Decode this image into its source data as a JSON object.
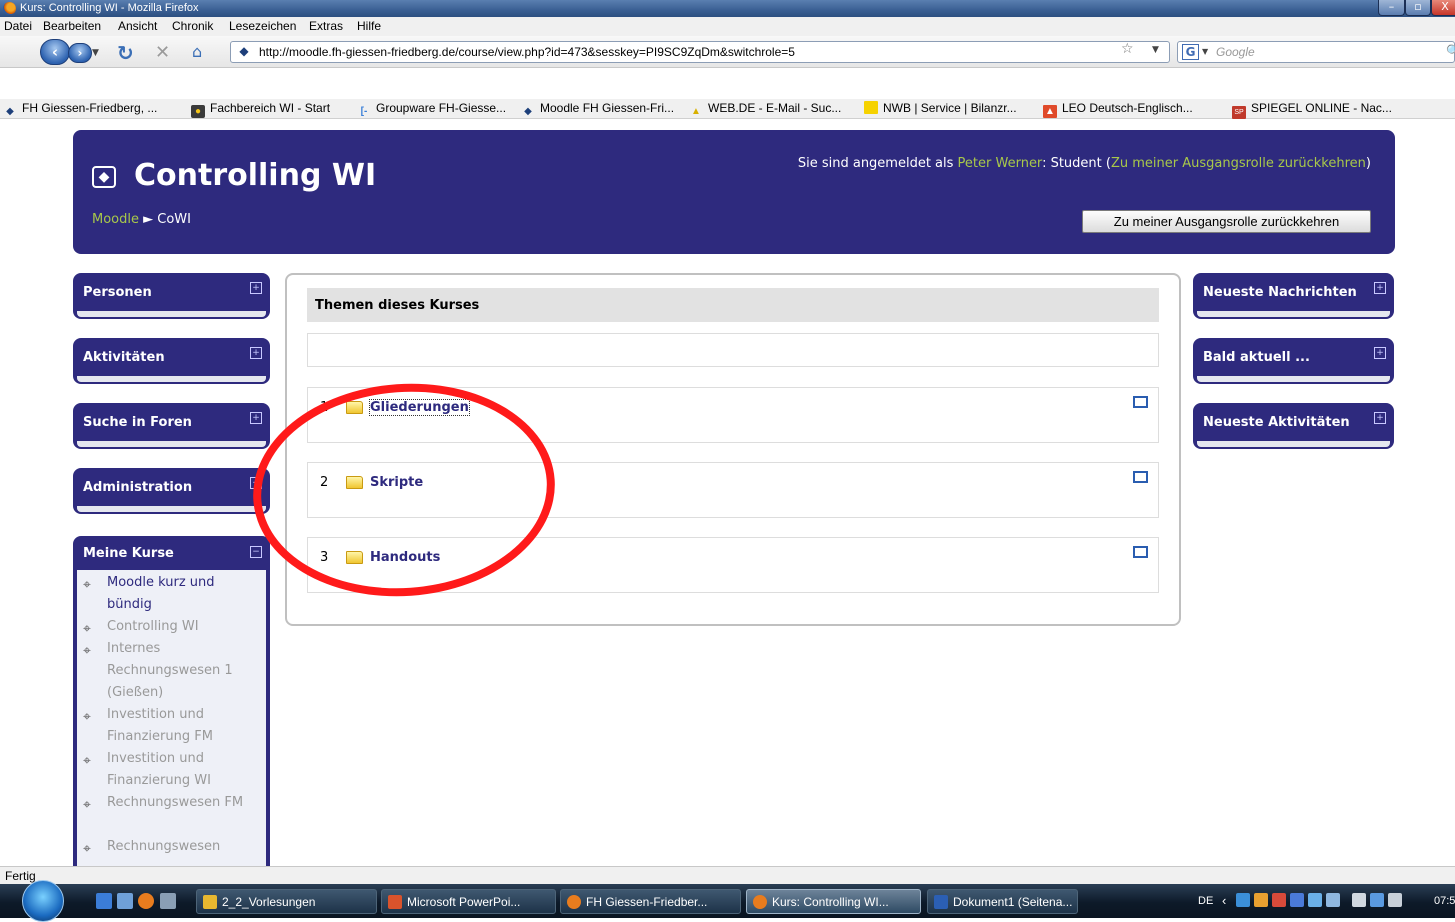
{
  "window": {
    "title": "Kurs: Controlling WI - Mozilla Firefox",
    "controls": {
      "minimize": "–",
      "maximize": "▫",
      "close": "X"
    }
  },
  "menubar": [
    "Datei",
    "Bearbeiten",
    "Ansicht",
    "Chronik",
    "Lesezeichen",
    "Extras",
    "Hilfe"
  ],
  "navbar": {
    "url": "http://moodle.fh-giessen-friedberg.de/course/view.php?id=473&sesskey=PI9SC9ZqDm&switchrole=5",
    "search_placeholder": "Google",
    "search_engine": "G"
  },
  "bookmarks": [
    {
      "label": "FH Giessen-Friedberg, ...",
      "icon": "moodle-diamond-icon"
    },
    {
      "label": "Fachbereich WI - Start",
      "icon": "fachbereich-icon"
    },
    {
      "label": "Groupware FH-Giesse...",
      "icon": "groupware-icon"
    },
    {
      "label": "Moodle FH Giessen-Fri...",
      "icon": "moodle-diamond-icon"
    },
    {
      "label": "WEB.DE - E-Mail - Suc...",
      "icon": "webde-icon"
    },
    {
      "label": "NWB | Service | Bilanzr...",
      "icon": "nwb-icon"
    },
    {
      "label": "LEO Deutsch-Englisch...",
      "icon": "leo-icon"
    },
    {
      "label": "SPIEGEL ONLINE - Nac...",
      "icon": "spiegel-icon"
    }
  ],
  "header": {
    "course_title": "Controlling WI",
    "login_prefix": "Sie sind angemeldet als ",
    "user_name": "Peter Werner",
    "role_text": ": Student (",
    "role_link": "Zu meiner Ausgangsrolle zurückkehren",
    "role_suffix": ")",
    "breadcrumb_home": "Moodle",
    "breadcrumb_sep": "►",
    "breadcrumb_current": "CoWI",
    "return_button": "Zu meiner Ausgangsrolle zurückkehren"
  },
  "left_blocks": [
    "Personen",
    "Aktivitäten",
    "Suche in Foren",
    "Administration"
  ],
  "my_courses": {
    "title": "Meine Kurse",
    "items": [
      {
        "label": "Moodle kurz und bündig",
        "state": "active"
      },
      {
        "label": "Controlling WI",
        "state": "dim"
      },
      {
        "label": "Internes Rechnungswesen 1 (Gießen)",
        "state": "dim"
      },
      {
        "label": "Investition und Finanzierung FM",
        "state": "dim"
      },
      {
        "label": "Investition und Finanzierung WI",
        "state": "dim"
      },
      {
        "label": "Rechnungswesen FM",
        "state": "dim"
      },
      {
        "label": "Rechnungswesen",
        "state": "dim"
      }
    ]
  },
  "right_blocks": [
    "Neueste Nachrichten",
    "Bald aktuell ...",
    "Neueste Aktivitäten"
  ],
  "content": {
    "heading": "Themen dieses Kurses",
    "topics": [
      {
        "number": "1",
        "label": "Gliederungen"
      },
      {
        "number": "2",
        "label": "Skripte"
      },
      {
        "number": "3",
        "label": "Handouts"
      }
    ]
  },
  "annotation": {
    "shape": "ellipse",
    "color": "#ff1a1a"
  },
  "statusbar": "Fertig",
  "taskbar": {
    "tasks": [
      {
        "label": "2_2_Vorlesungen",
        "icon_color": "#e8b830",
        "active": false
      },
      {
        "label": "Microsoft PowerPoi...",
        "icon_color": "#d9532c",
        "active": false
      },
      {
        "label": "FH Giessen-Friedber...",
        "icon_color": "#e87c1e",
        "active": false
      },
      {
        "label": "Kurs: Controlling WI...",
        "icon_color": "#e87c1e",
        "active": true
      },
      {
        "label": "Dokument1 (Seitena...",
        "icon_color": "#2b5fb4",
        "active": false
      }
    ],
    "language": "DE",
    "clock": "07:5"
  },
  "colors": {
    "moodle_purple": "#2e2a7e",
    "link_green": "#a8c84a",
    "annotation_red": "#ff1a1a"
  }
}
